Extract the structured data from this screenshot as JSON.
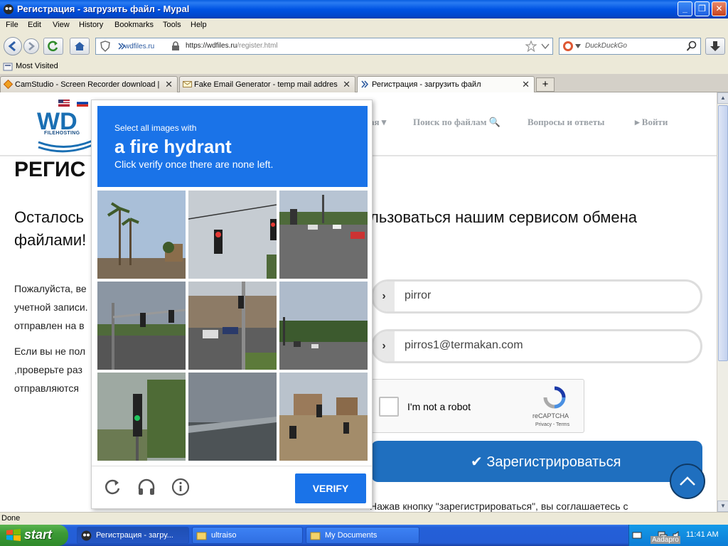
{
  "window": {
    "title": "Регистрация - загрузить файл - Mypal",
    "min_glyph": "_",
    "max_glyph": "❐",
    "close_glyph": "✕"
  },
  "menu": {
    "items": [
      "File",
      "Edit",
      "View",
      "History",
      "Bookmarks",
      "Tools",
      "Help"
    ]
  },
  "nav": {
    "site_identity": "wdfiles.ru",
    "url_base": "https://wdfiles.ru",
    "url_path": "/register.html",
    "search_placeholder": "DuckDuckGo"
  },
  "bookmarks": {
    "items": [
      "Most Visited"
    ]
  },
  "tabs": [
    {
      "label": "CamStudio - Screen Recorder download |...",
      "active": false
    },
    {
      "label": "Fake Email Generator - temp mail address",
      "active": false
    },
    {
      "label": "Регистрация - загрузить файл",
      "active": true
    }
  ],
  "new_tab_label": "+",
  "tab_close_glyph": "✕",
  "site": {
    "logo": "WD",
    "logo_sub": "FILEHOSTING",
    "nav_links": [
      "ая ▾",
      "Поиск по файлам 🔍",
      "Вопросы и ответы",
      "▸ Войти"
    ],
    "heading": "РЕГИС",
    "lead_line1_left": "Осталось",
    "lead_line1_right": "льзоваться нашим сервисом обмена",
    "lead_line2": "файлами!",
    "para1": [
      "Пожалуйста, ве",
      "учетной записи.",
      "отправлен на в"
    ],
    "para2": [
      "Если вы не пол",
      ",проверьте раз",
      "отправляются"
    ],
    "field_username": "pirror",
    "field_email": "pirros1@termakan.com",
    "recaptcha_label": "I'm not a robot",
    "recaptcha_brand": "reCAPTCHA",
    "recaptcha_terms": "Privacy - Terms",
    "register_button": "✔ Зарегистрироваться",
    "agree_text": "Нажав кнопку \"зарегистрироваться\", вы соглашаетесь с",
    "field_chevron": "›"
  },
  "captcha": {
    "line1": "Select all images with",
    "line2": "a fire hydrant",
    "line3": "Click verify once there are none left.",
    "verify": "VERIFY",
    "icons": [
      "reload-icon",
      "audio-icon",
      "info-icon"
    ],
    "tile_count": 9
  },
  "status": {
    "text": "Done"
  },
  "taskbar": {
    "start": "start",
    "tasks": [
      {
        "label": "Регистрация - загру...",
        "active": true
      },
      {
        "label": "ultraiso",
        "active": false
      },
      {
        "label": "My Documents",
        "active": false
      }
    ],
    "clock": "11:41 AM",
    "tray_tag": "Aadapro"
  },
  "colors": {
    "captcha_blue": "#1a73e8",
    "site_blue": "#1f6fbf",
    "xp_titlebar": "#0054E3",
    "xp_start": "#3c9a36"
  }
}
